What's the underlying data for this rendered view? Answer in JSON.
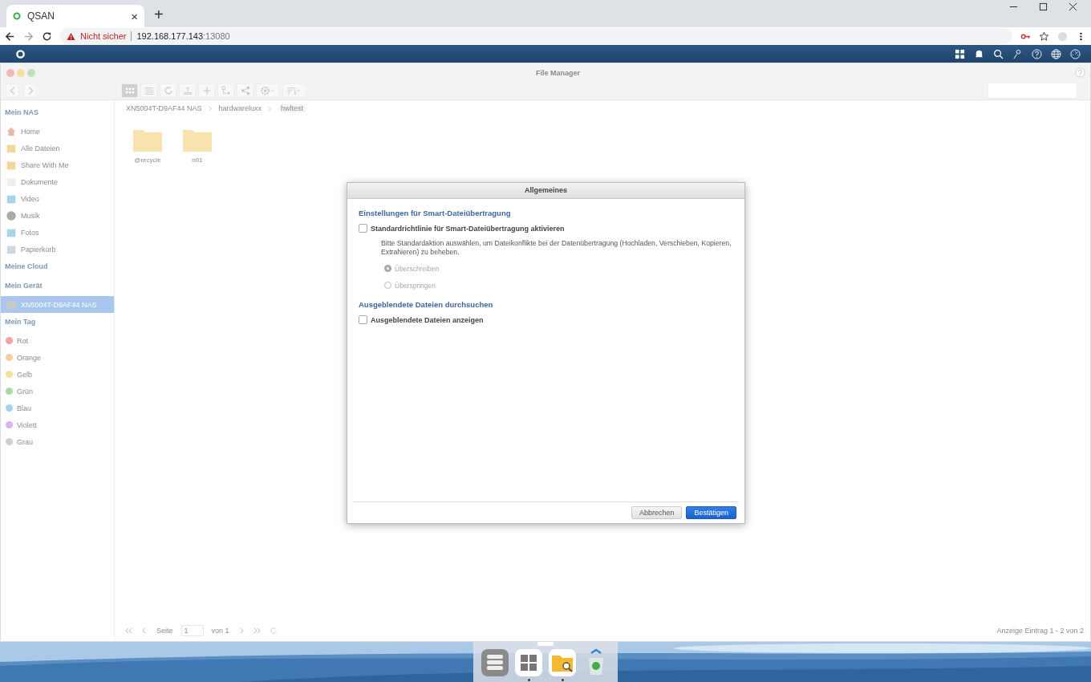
{
  "browser": {
    "tab_title": "QSAN",
    "tab_close": "×",
    "new_tab": "+",
    "security": "Nicht sicher",
    "url_host": "192.168.177.143",
    "url_port": ":13080"
  },
  "window": {
    "title": "File Manager"
  },
  "toolbar": {
    "view_modes": [
      {
        "selected": true
      },
      {
        "selected": false
      }
    ]
  },
  "breadcrumb": [
    "XN5004T-D9AF44 NAS",
    "hardwareluxx",
    "hwltest"
  ],
  "sidebar": [
    {
      "title": "Mein NAS",
      "items": [
        {
          "label": "Home",
          "selected": false
        },
        {
          "label": "Alle Dateien",
          "selected": false
        },
        {
          "label": "Share With Me",
          "selected": false
        },
        {
          "label": "Dokumente",
          "selected": false
        },
        {
          "label": "Video",
          "selected": false
        },
        {
          "label": "Musik",
          "selected": false
        },
        {
          "label": "Fotos",
          "selected": false
        },
        {
          "label": "Papierkorb",
          "selected": false
        }
      ]
    },
    {
      "title": "Meine Cloud"
    },
    {
      "title": "Mein Gerät",
      "items": [
        {
          "label": "XN5004T-D9AF44 NAS",
          "selected": true
        }
      ]
    },
    {
      "title": "Mein Tag",
      "tags": [
        {
          "label": "Rot",
          "color": "#f4a3a3"
        },
        {
          "label": "Orange",
          "color": "#f8cf9a"
        },
        {
          "label": "Gelb",
          "color": "#f6e39a"
        },
        {
          "label": "Grün",
          "color": "#a9dca3"
        },
        {
          "label": "Blau",
          "color": "#a6d2f0"
        },
        {
          "label": "Violett",
          "color": "#dcb2ea"
        },
        {
          "label": "Grau",
          "color": "#cfcfcf"
        }
      ]
    }
  ],
  "files": [
    {
      "name": "@recycle"
    },
    {
      "name": "n01"
    }
  ],
  "pagination": {
    "page_label": "Seite",
    "page": "1",
    "of": "von 1",
    "summary": "Anzeige Eintrag 1 - 2 von 2"
  },
  "dialog": {
    "title": "Allgemeines",
    "sections": [
      {
        "heading": "Einstellungen für Smart-Dateiübertragung",
        "options": [
          {
            "label": "Standardrichtlinie für Smart-Dateiübertragung aktivieren",
            "checked": false,
            "description": "Bitte Standardaktion auswählen, um Dateikonflikte bei der Datenübertragung (Hochladen, Verschieben, Kopieren, Extrahieren) zu beheben.",
            "choices": [
              {
                "label": "Überschreiben",
                "selected": true,
                "disabled": true
              },
              {
                "label": "Überspringen",
                "selected": false,
                "disabled": true
              }
            ]
          }
        ]
      },
      {
        "heading": "Ausgeblendete Dateien durchsuchen",
        "options": [
          {
            "label": "Ausgeblendete Dateien anzeigen",
            "checked": false
          }
        ]
      }
    ],
    "buttons": [
      {
        "label": "Abbrechen",
        "kind": "secondary"
      },
      {
        "label": "Bestätigen",
        "kind": "primary"
      }
    ]
  },
  "dock": [
    {
      "running": false
    },
    {
      "running": true
    },
    {
      "running": true
    },
    {
      "running": false
    }
  ]
}
